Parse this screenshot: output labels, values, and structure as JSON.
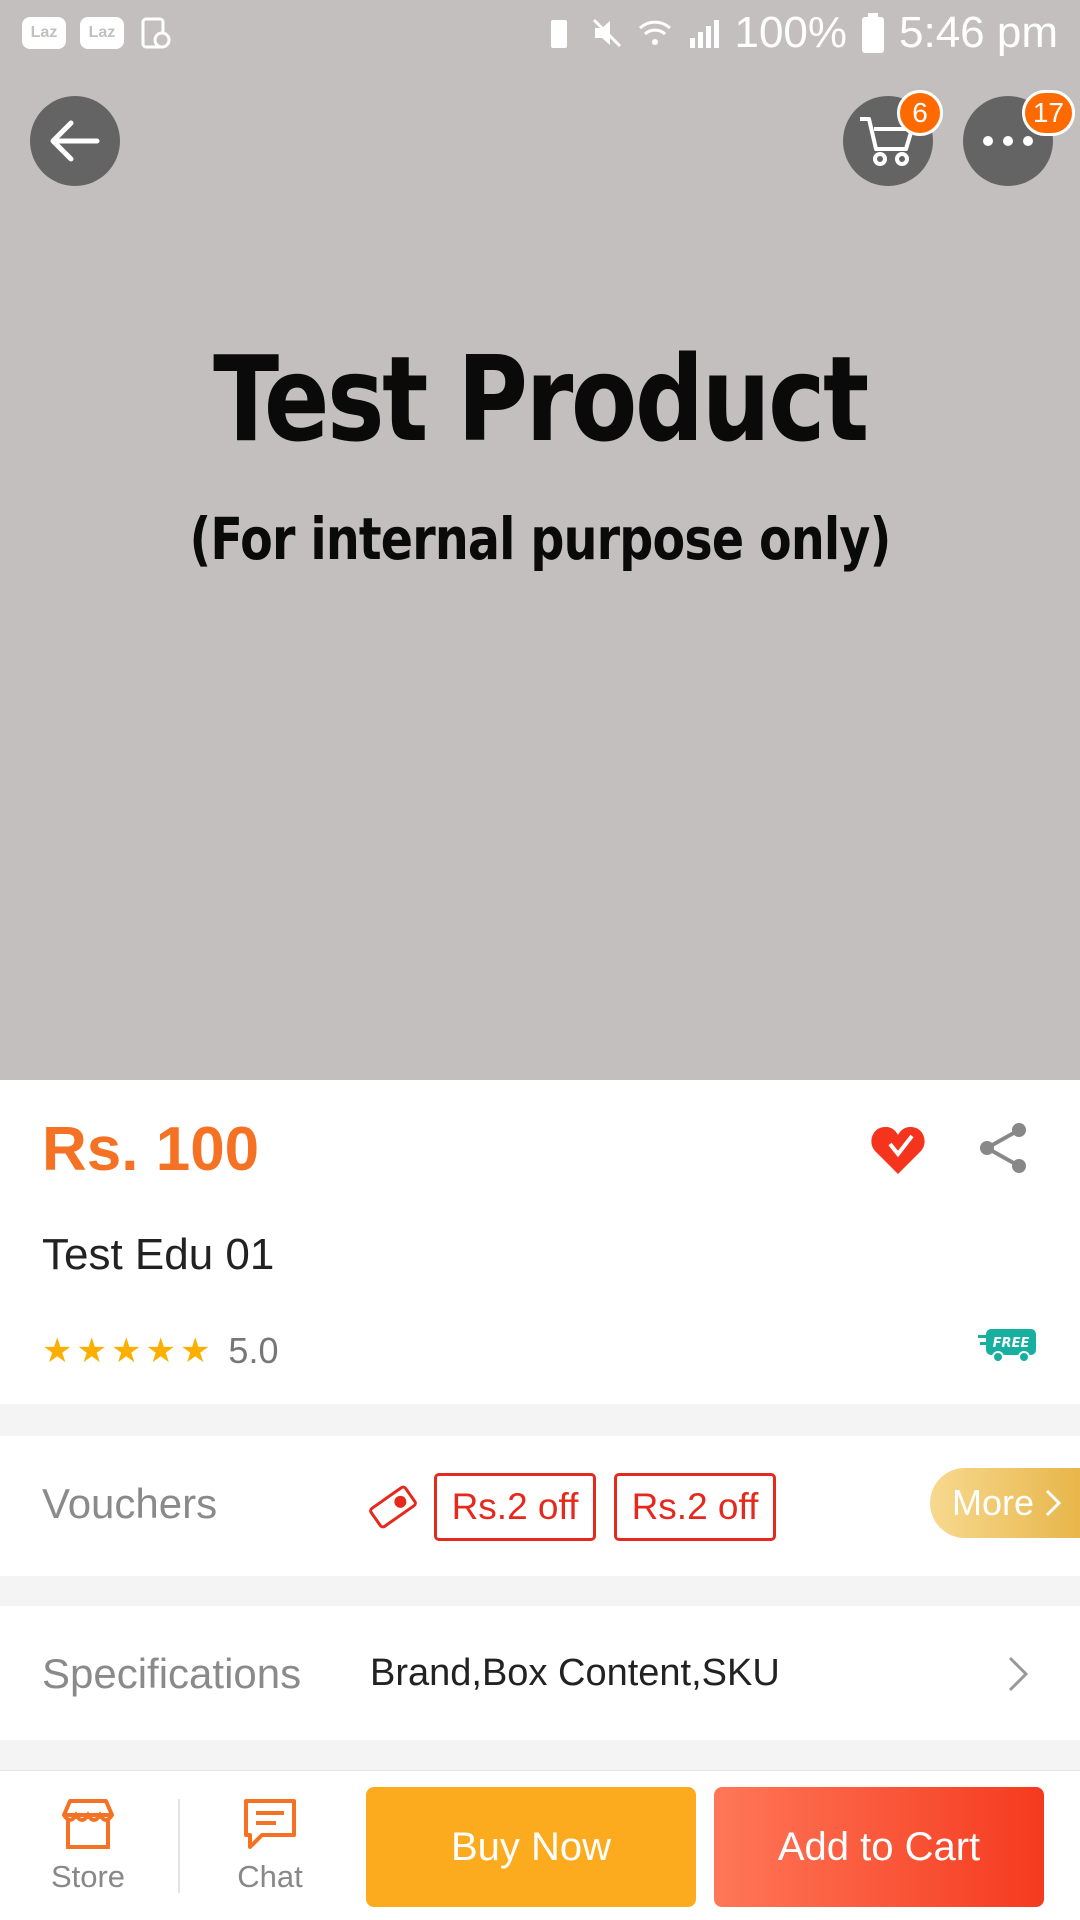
{
  "status_bar": {
    "left_icons": [
      "Laz",
      "Laz"
    ],
    "battery": "100%",
    "time": "5:46 pm"
  },
  "header": {
    "cart_badge": "6",
    "more_badge": "17"
  },
  "product_image": {
    "title": "Test Product",
    "subtitle": "(For internal purpose only)"
  },
  "product": {
    "price": "Rs. 100",
    "name": "Test Edu 01",
    "rating": "5.0",
    "stars": 5,
    "free_badge": "FREE"
  },
  "vouchers": {
    "label": "Vouchers",
    "items": [
      "Rs.2 off",
      "Rs.2 off"
    ],
    "more_label": "More"
  },
  "specifications": {
    "label": "Specifications",
    "value": "Brand,Box Content,SKU"
  },
  "bottom_bar": {
    "store_label": "Store",
    "chat_label": "Chat",
    "buy_now_label": "Buy Now",
    "add_to_cart_label": "Add to Cart"
  },
  "colors": {
    "price": "#f57224",
    "buy_now": "#fdab1e",
    "add_to_cart": "#f53a1e",
    "voucher": "#e5291d",
    "hero_bg": "#c4bfbf"
  }
}
